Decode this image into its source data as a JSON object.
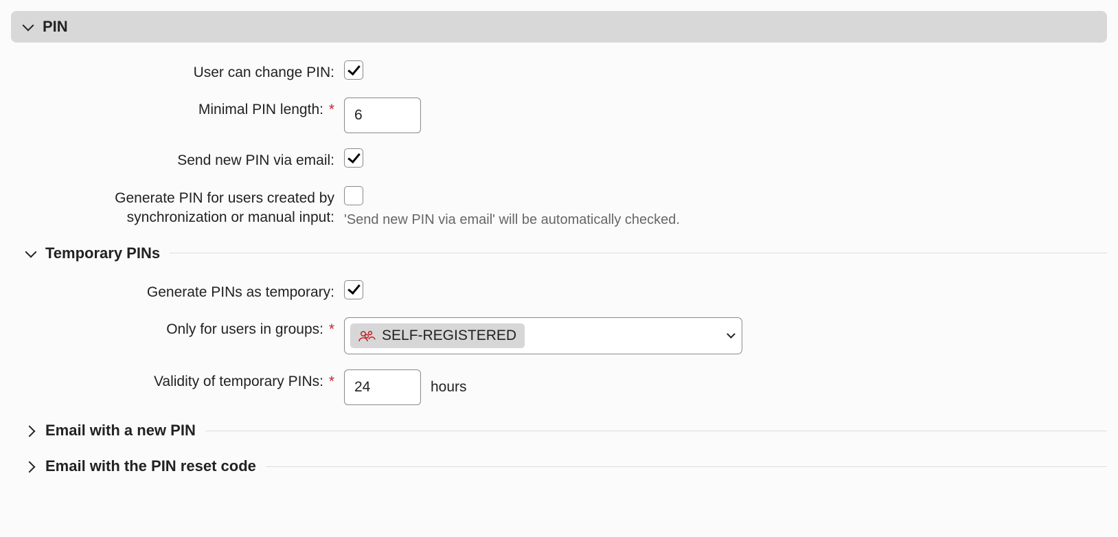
{
  "panel": {
    "title": "PIN"
  },
  "fields": {
    "user_can_change": {
      "label": "User can change PIN:"
    },
    "min_length": {
      "label": "Minimal PIN length:",
      "value": "6"
    },
    "send_email": {
      "label": "Send new PIN via email:"
    },
    "gen_for_sync": {
      "label": "Generate PIN for users created by synchronization or manual input:",
      "help": "'Send new PIN via email' will be automatically checked."
    }
  },
  "temp": {
    "section_title": "Temporary PINs",
    "generate_temp": {
      "label": "Generate PINs as temporary:"
    },
    "only_groups": {
      "label": "Only for users in groups:",
      "tag": "SELF-REGISTERED"
    },
    "validity": {
      "label": "Validity of temporary PINs:",
      "value": "24",
      "unit": "hours"
    }
  },
  "sections": {
    "email_new_pin": "Email with a new PIN",
    "email_reset_code": "Email with the PIN reset code"
  },
  "required_marker": "*"
}
